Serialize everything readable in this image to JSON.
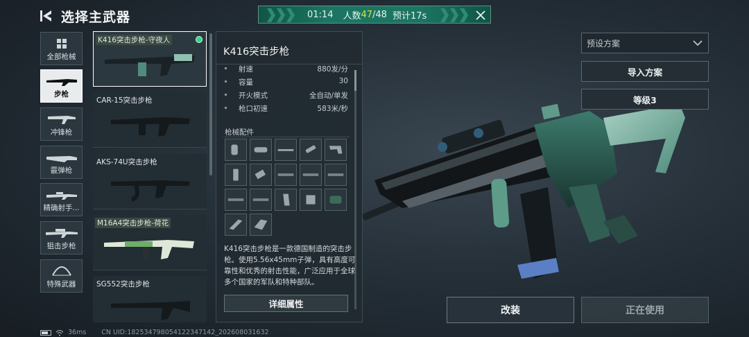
{
  "header": {
    "title": "选择主武器"
  },
  "match": {
    "time": "01:14",
    "players_label": "人数",
    "players_current": "47",
    "players_total": "/48",
    "eta": "预计17s"
  },
  "categories": [
    {
      "label": "全部枪械",
      "icon": "grid-icon"
    },
    {
      "label": "步枪",
      "icon": "rifle-icon",
      "active": true
    },
    {
      "label": "冲锋枪",
      "icon": "smg-icon"
    },
    {
      "label": "霰弹枪",
      "icon": "shotgun-icon"
    },
    {
      "label": "精确射手...",
      "icon": "dmr-icon"
    },
    {
      "label": "狙击步枪",
      "icon": "sniper-icon"
    },
    {
      "label": "特殊武器",
      "icon": "bow-icon"
    }
  ],
  "weapons": [
    {
      "name": "K416突击步枪-守夜人",
      "skin": true,
      "selected": true
    },
    {
      "name": "CAR-15突击步枪"
    },
    {
      "name": "AKS-74U突击步枪"
    },
    {
      "name": "M16A4突击步枪-荷花",
      "skin": true
    },
    {
      "name": "SG552突击步枪"
    }
  ],
  "detail": {
    "title": "K416突击步枪",
    "stats": [
      {
        "key": "射速",
        "value": "880发/分"
      },
      {
        "key": "容量",
        "value": "30"
      },
      {
        "key": "开火模式",
        "value": "全自动/单发"
      },
      {
        "key": "枪口初速",
        "value": "583米/秒"
      }
    ],
    "attachments_label": "枪械配件",
    "attachments": [
      "grip",
      "scope",
      "barrel",
      "suppressor",
      "stock",
      "magazine",
      "laser",
      "rail",
      "rail",
      "rail",
      "rail",
      "rail",
      "magazine-curved",
      "sight",
      "optic",
      "stock-alt",
      "handguard"
    ],
    "description": "K416突击步枪是一款德国制造的突击步枪。使用5.56x45mm子弹，具有高度可靠性和优秀的射击性能，广泛应用于全球多个国家的军队和特种部队。",
    "detail_button": "详细属性"
  },
  "right": {
    "preset_placeholder": "预设方案",
    "import_button": "导入方案",
    "level_button": "等级3",
    "modify_button": "改装",
    "in_use_button": "正在使用"
  },
  "status": {
    "ping": "36ms",
    "uid": "CN UID:1825347980541223471​42_202608031632"
  },
  "colors": {
    "accent_green": "#1c7562",
    "highlight_yellow": "#d6e24a",
    "selected_dot": "#2fd68a"
  }
}
